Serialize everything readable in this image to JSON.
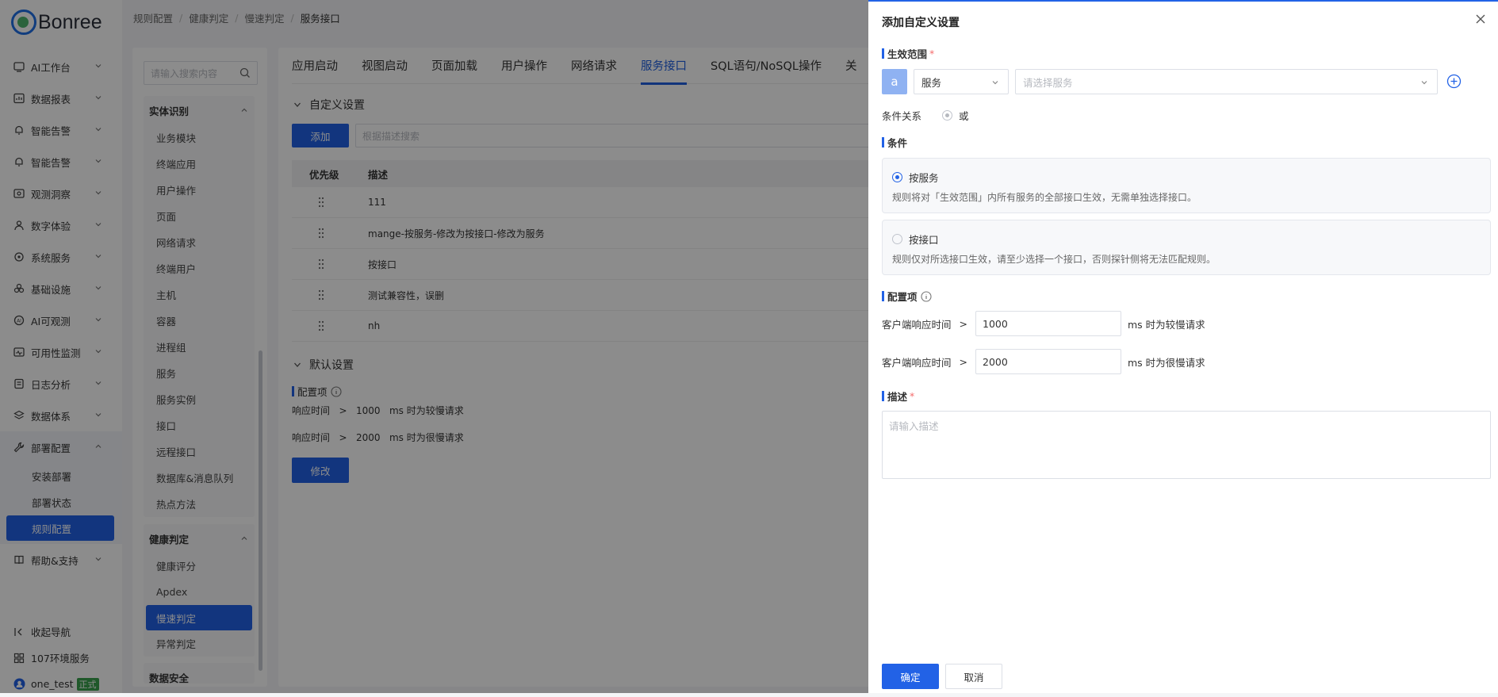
{
  "brand": {
    "name": "Bonree"
  },
  "nav": {
    "items": [
      {
        "label": "AI工作台",
        "icon": "ai-workbench-icon"
      },
      {
        "label": "数据报表",
        "icon": "report-icon"
      },
      {
        "label": "智能告警",
        "icon": "alert-icon"
      },
      {
        "label": "智能告警",
        "icon": "alert-icon"
      },
      {
        "label": "观测洞察",
        "icon": "insight-icon"
      },
      {
        "label": "数字体验",
        "icon": "experience-icon"
      },
      {
        "label": "系统服务",
        "icon": "system-service-icon"
      },
      {
        "label": "基础设施",
        "icon": "infrastructure-icon"
      },
      {
        "label": "AI可观测",
        "icon": "ai-observe-icon"
      },
      {
        "label": "可用性监测",
        "icon": "availability-icon"
      },
      {
        "label": "日志分析",
        "icon": "log-icon"
      },
      {
        "label": "数据体系",
        "icon": "data-system-icon"
      }
    ],
    "deploy": {
      "label": "部署配置",
      "subs": [
        "安装部署",
        "部署状态",
        "规则配置"
      ]
    },
    "help": "帮助&支持",
    "collapse": "收起导航",
    "env": "107环境服务",
    "user": "one_test",
    "user_badge": "正式"
  },
  "breadcrumb": [
    "规则配置",
    "健康判定",
    "慢速判定",
    "服务接口"
  ],
  "entity_panel": {
    "search_placeholder": "请输入搜索内容",
    "group1": {
      "title": "实体识别",
      "items": [
        "业务模块",
        "终端应用",
        "用户操作",
        "页面",
        "网络请求",
        "终端用户",
        "主机",
        "容器",
        "进程组",
        "服务",
        "服务实例",
        "接口",
        "远程接口",
        "数据库&消息队列",
        "热点方法"
      ]
    },
    "group2": {
      "title": "健康判定",
      "items": [
        "健康评分",
        "Apdex",
        "慢速判定",
        "异常判定"
      ]
    },
    "group3_title": "数据安全"
  },
  "main": {
    "tabs": [
      "应用启动",
      "视图启动",
      "页面加载",
      "用户操作",
      "网络请求",
      "服务接口",
      "SQL语句/NoSQL操作",
      "关"
    ],
    "custom_title": "自定义设置",
    "add_label": "添加",
    "desc_search_placeholder": "根据描述搜索",
    "table_headers": [
      "优先级",
      "描述"
    ],
    "rows": [
      "111",
      "mange-按服务-修改为按接口-修改为服务",
      "按接口",
      "测试兼容性，误删",
      "nh"
    ],
    "default_title": "默认设置",
    "config_label": "配置项",
    "config_lines": [
      {
        "metric": "响应时间",
        "op": ">",
        "value": "1000",
        "suffix": "ms 时为较慢请求"
      },
      {
        "metric": "响应时间",
        "op": ">",
        "value": "2000",
        "suffix": "ms 时为很慢请求"
      }
    ],
    "edit_label": "修改"
  },
  "drawer": {
    "title": "添加自定义设置",
    "scope_label": "生效范围",
    "required_mark": "*",
    "scope_badge": "a",
    "scope_type": "服务",
    "service_placeholder": "请选择服务",
    "cond_rel_label": "条件关系",
    "cond_rel_value": "或",
    "conditions_label": "条件",
    "option_service": {
      "title": "按服务",
      "desc": "规则将对「生效范围」内所有服务的全部接口生效，无需单独选择接口。"
    },
    "option_interface": {
      "title": "按接口",
      "desc": "规则仅对所选接口生效，请至少选择一个接口，否则探针侧将无法匹配规则。"
    },
    "config_label": "配置项",
    "config_rows": [
      {
        "metric": "客户端响应时间",
        "op": ">",
        "value": "1000",
        "suffix": "ms 时为较慢请求"
      },
      {
        "metric": "客户端响应时间",
        "op": ">",
        "value": "2000",
        "suffix": "ms 时为很慢请求"
      }
    ],
    "desc_label": "描述",
    "desc_placeholder": "请输入描述",
    "ok_label": "确定",
    "cancel_label": "取消"
  },
  "colors": {
    "accent": "#2262e6",
    "overlay": "rgba(0,0,0,0.45)",
    "badge_green": "#39a14e"
  }
}
